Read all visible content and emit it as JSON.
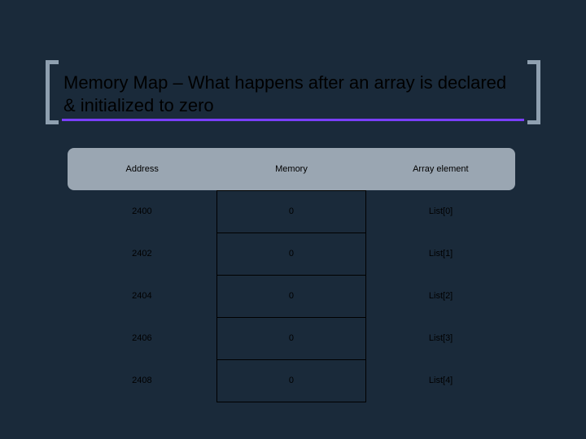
{
  "title": "Memory Map – What happens after an array is declared & initialized to zero",
  "columns": [
    "Address",
    "Memory",
    "Array element"
  ],
  "rows": [
    {
      "address": "2400",
      "memory": "0",
      "element": "List[0]"
    },
    {
      "address": "2402",
      "memory": "0",
      "element": "List[1]"
    },
    {
      "address": "2404",
      "memory": "0",
      "element": "List[2]"
    },
    {
      "address": "2406",
      "memory": "0",
      "element": "List[3]"
    },
    {
      "address": "2408",
      "memory": "0",
      "element": "List[4]"
    }
  ],
  "chart_data": {
    "type": "table",
    "title": "Memory Map – array declared and initialized to zero",
    "columns": [
      "Address",
      "Memory",
      "Array element"
    ],
    "data": [
      [
        2400,
        0,
        "List[0]"
      ],
      [
        2402,
        0,
        "List[1]"
      ],
      [
        2404,
        0,
        "List[2]"
      ],
      [
        2406,
        0,
        "List[3]"
      ],
      [
        2408,
        0,
        "List[4]"
      ]
    ]
  }
}
